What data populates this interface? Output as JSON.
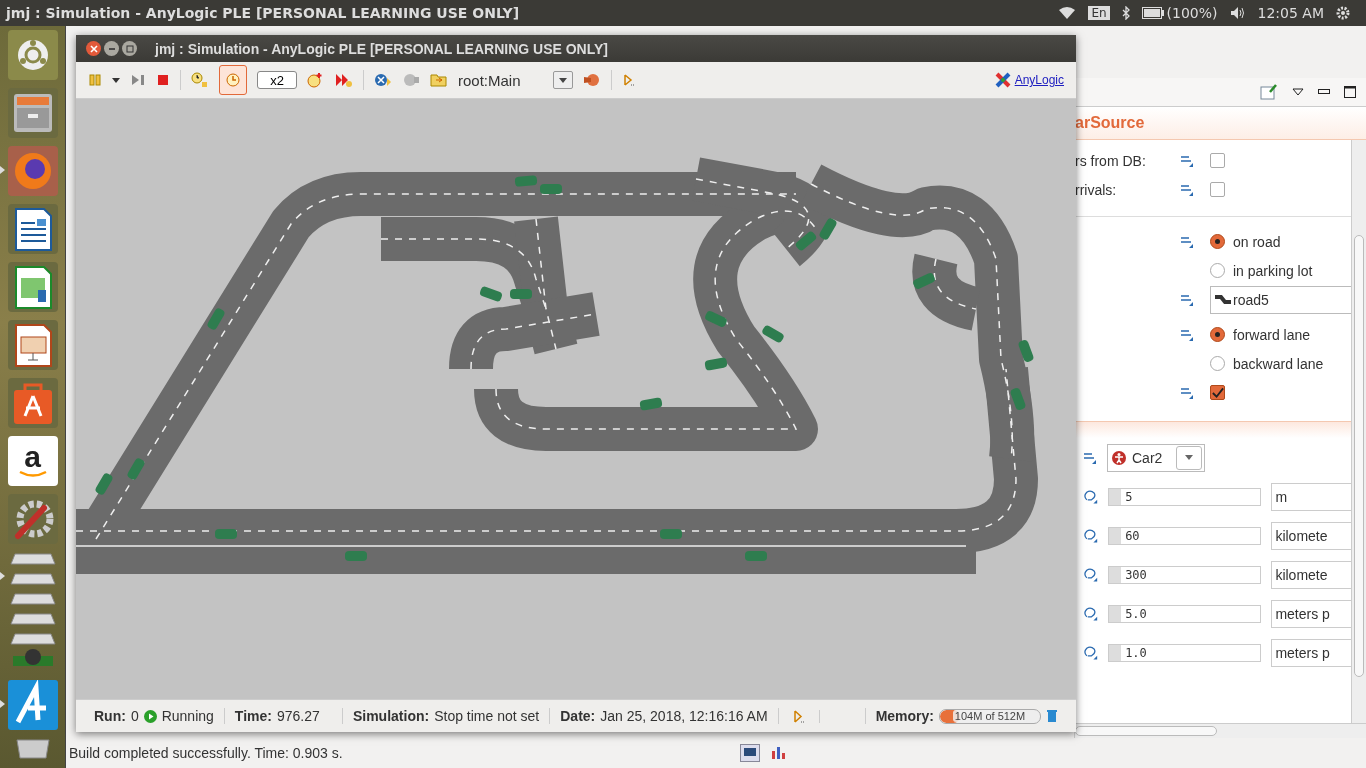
{
  "top_panel": {
    "title": "jmj : Simulation - AnyLogic PLE [PERSONAL LEARNING USE ONLY]",
    "keyboard": "En",
    "battery": "(100%)",
    "clock": "12:05 AM"
  },
  "launcher": [
    {
      "kind": "home",
      "running": false
    },
    {
      "kind": "files",
      "running": false
    },
    {
      "kind": "browser",
      "running": true
    },
    {
      "kind": "writer",
      "running": false
    },
    {
      "kind": "calc",
      "running": false
    },
    {
      "kind": "impress",
      "running": false
    },
    {
      "kind": "store",
      "running": false
    },
    {
      "kind": "amazon",
      "running": false,
      "glyph": "a"
    },
    {
      "kind": "settings",
      "running": false
    },
    {
      "kind": "stack",
      "running": true
    },
    {
      "kind": "anylogic",
      "running": true
    },
    {
      "kind": "trash",
      "running": false
    }
  ],
  "ide": {
    "build_status": "Build completed successfully. Time: 0.903 s."
  },
  "sim_window": {
    "title": "jmj : Simulation - AnyLogic PLE [PERSONAL LEARNING USE ONLY]",
    "toolbar": {
      "speed": "x2",
      "realtime_selected": true,
      "root": "root:Main",
      "brand": "AnyLogic"
    },
    "status": {
      "run_label": "Run:",
      "run": "0",
      "state": "Running",
      "time_label": "Time:",
      "time": "976.27",
      "sim_label": "Simulation:",
      "sim": "Stop time not set",
      "date_label": "Date:",
      "date": "Jan 25, 2018, 12:16:16 AM",
      "memory_label": "Memory:",
      "memory": "104M of 512M",
      "level": 0.2
    }
  },
  "properties": {
    "title": "arSource",
    "rows": [
      {
        "kind": "checkbox",
        "label": "rs from DB:",
        "checked": false
      },
      {
        "kind": "checkbox",
        "label": "rrivals:",
        "checked": false
      },
      {
        "kind": "divider"
      },
      {
        "kind": "radio",
        "options": [
          {
            "label": "on road",
            "selected": true
          },
          {
            "label": "in parking lot",
            "selected": false
          }
        ]
      },
      {
        "kind": "road",
        "value": "road5"
      },
      {
        "kind": "radio",
        "options": [
          {
            "label": "forward lane",
            "selected": true
          },
          {
            "label": "backward lane",
            "selected": false
          }
        ]
      },
      {
        "kind": "checkbox",
        "label": "",
        "checked": true
      }
    ],
    "params": [
      {
        "kind": "combo",
        "value": "Car2"
      },
      {
        "kind": "number",
        "value": "5",
        "unit": "m"
      },
      {
        "kind": "number",
        "value": "60",
        "unit": "kilomete"
      },
      {
        "kind": "number",
        "value": "300",
        "unit": "kilomete"
      },
      {
        "kind": "number",
        "value": "5.0",
        "unit": "meters p"
      },
      {
        "kind": "number",
        "value": "1.0",
        "unit": "meters p"
      }
    ]
  }
}
